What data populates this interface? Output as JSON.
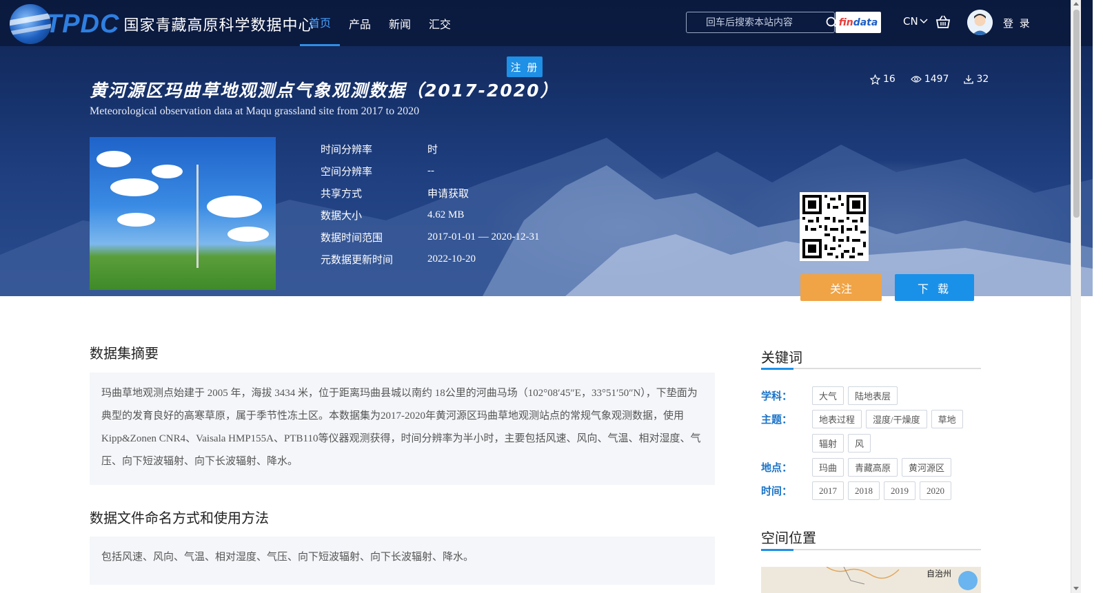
{
  "header": {
    "logo_abbr": "TPDC",
    "logo_name": "国家青藏高原科学数据中心",
    "nav": [
      {
        "label": "首页",
        "active": true
      },
      {
        "label": "产品",
        "active": false
      },
      {
        "label": "新闻",
        "active": false
      },
      {
        "label": "汇交",
        "active": false
      }
    ],
    "search_placeholder": "回车后搜索本站内容",
    "findata_a": "fin",
    "findata_b": "data",
    "lang": "CN",
    "login": "登 录",
    "register": "注 册"
  },
  "dataset": {
    "title_cn": "黄河源区玛曲草地观测点气象观测数据（2017-2020）",
    "title_en": "Meteorological observation data at Maqu grassland site from 2017 to 2020",
    "stats": {
      "stars": "16",
      "views": "1497",
      "downloads": "32"
    },
    "info": [
      {
        "k": "时间分辨率",
        "v": "时"
      },
      {
        "k": "空间分辨率",
        "v": "--"
      },
      {
        "k": "共享方式",
        "v": "申请获取"
      },
      {
        "k": "数据大小",
        "v": "4.62 MB"
      },
      {
        "k": "数据时间范围",
        "v": "2017-01-01 — 2020-12-31"
      },
      {
        "k": "元数据更新时间",
        "v": "2022-10-20"
      }
    ],
    "follow_label": "关注",
    "download_label": "下 载"
  },
  "sections": {
    "abstract_title": "数据集摘要",
    "abstract_text": "玛曲草地观测点始建于 2005 年，海拔 3434 米，位于距离玛曲县城以南约 18公里的河曲马场（102°08′45″E，33°51′50″N），下垫面为典型的发育良好的高寒草原，属于季节性冻土区。本数据集为2017-2020年黄河源区玛曲草地观测站点的常规气象观测数据，使用Kipp&Zonen CNR4、Vaisala HMP155A、PTB110等仪器观测获得，时间分辨率为半小时，主要包括风速、风向、气温、相对湿度、气压、向下短波辐射、向下长波辐射、降水。",
    "naming_title": "数据文件命名方式和使用方法",
    "naming_text": "包括风速、风向、气温、相对湿度、气压、向下短波辐射、向下长波辐射、降水。"
  },
  "keywords": {
    "title": "关键词",
    "rows": [
      {
        "label": "学科：",
        "tags": [
          "大气",
          "陆地表层"
        ]
      },
      {
        "label": "主题：",
        "tags": [
          "地表过程",
          "湿度/干燥度",
          "草地",
          "辐射",
          "风"
        ]
      },
      {
        "label": "地点：",
        "tags": [
          "玛曲",
          "青藏高原",
          "黄河源区"
        ]
      },
      {
        "label": "时间：",
        "tags": [
          "2017",
          "2018",
          "2019",
          "2020"
        ]
      }
    ]
  },
  "location": {
    "title": "空间位置",
    "map_label": "自治州"
  }
}
